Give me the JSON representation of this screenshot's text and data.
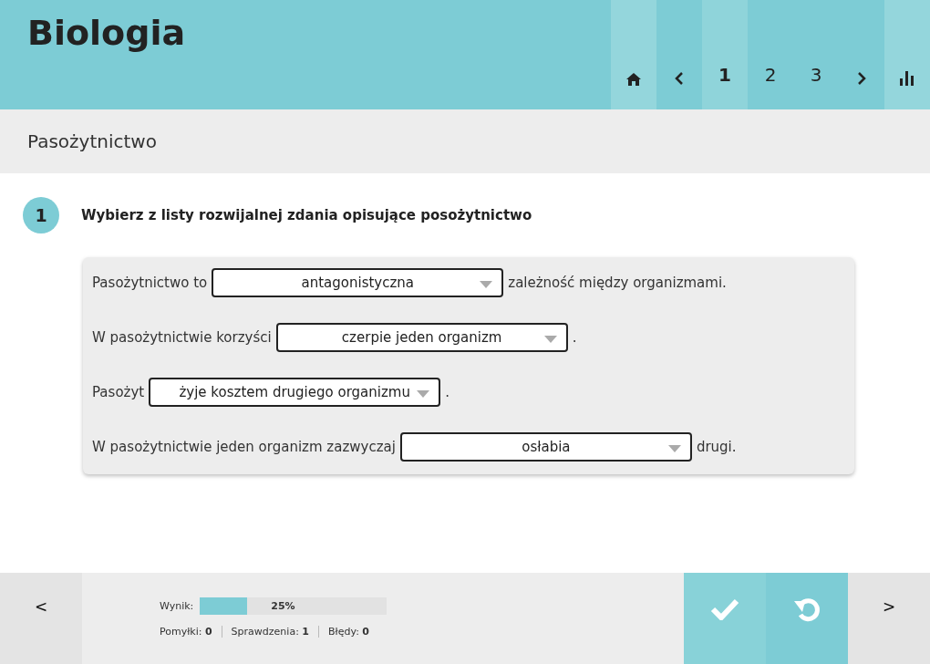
{
  "header": {
    "title": "Biologia",
    "pages": [
      {
        "label": "1",
        "selected": true
      },
      {
        "label": "2",
        "selected": false
      },
      {
        "label": "3",
        "selected": false
      }
    ]
  },
  "section": {
    "title": "Pasożytnictwo"
  },
  "question": {
    "number": "1",
    "text": "Wybierz z listy rozwijalnej zdania opisujące posożytnictwo",
    "sentences": [
      {
        "before": "Pasożytnictwo to",
        "value": "antagonistyczna",
        "after": "zależność między organizmami."
      },
      {
        "before": "W pasożytnictwie korzyści",
        "value": "czerpie jeden organizm",
        "after": "."
      },
      {
        "before": "Pasożyt",
        "value": "żyje kosztem drugiego organizmu",
        "after": "."
      },
      {
        "before": "W pasożytnictwie jeden organizm zazwyczaj",
        "value": "osłabia",
        "after": "drugi."
      }
    ]
  },
  "footer": {
    "prev": "<",
    "next": ">",
    "score_label": "Wynik:",
    "score": {
      "level": 0.25,
      "reading": "25%"
    },
    "stats": [
      {
        "label": "Pomyłki:",
        "value": "0"
      },
      {
        "label": "Sprawdzenia:",
        "value": "1"
      },
      {
        "label": "Błędy:",
        "value": "0"
      }
    ]
  }
}
